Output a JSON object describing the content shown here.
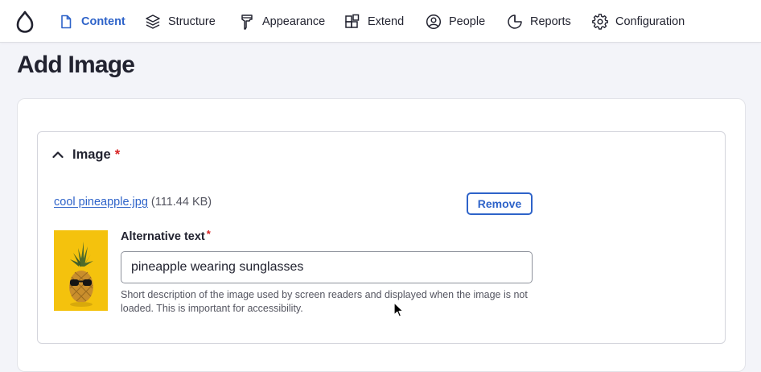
{
  "toolbar": {
    "items": [
      {
        "label": "Content",
        "icon": "document-icon",
        "active": true
      },
      {
        "label": "Structure",
        "icon": "layers-icon"
      },
      {
        "label": "Appearance",
        "icon": "paint-icon"
      },
      {
        "label": "Extend",
        "icon": "puzzle-icon"
      },
      {
        "label": "People",
        "icon": "person-icon"
      },
      {
        "label": "Reports",
        "icon": "pie-chart-icon"
      },
      {
        "label": "Configuration",
        "icon": "gear-icon"
      }
    ],
    "logo_icon": "drop-logo-icon"
  },
  "page": {
    "title": "Add Image"
  },
  "image_field": {
    "summary_label": "Image",
    "required_mark": "*",
    "file_name": "cool pineapple.jpg",
    "file_size": "(111.44 KB)",
    "remove_label": "Remove",
    "alt_label": "Alternative text",
    "alt_required_mark": "*",
    "alt_value": "pineapple wearing sunglasses",
    "alt_description": "Short description of the image used by screen readers and displayed when the image is not loaded. This is important for accessibility."
  },
  "colors": {
    "accent": "#2e63c9",
    "required": "#d72222",
    "page_bg": "#f3f4f9"
  }
}
